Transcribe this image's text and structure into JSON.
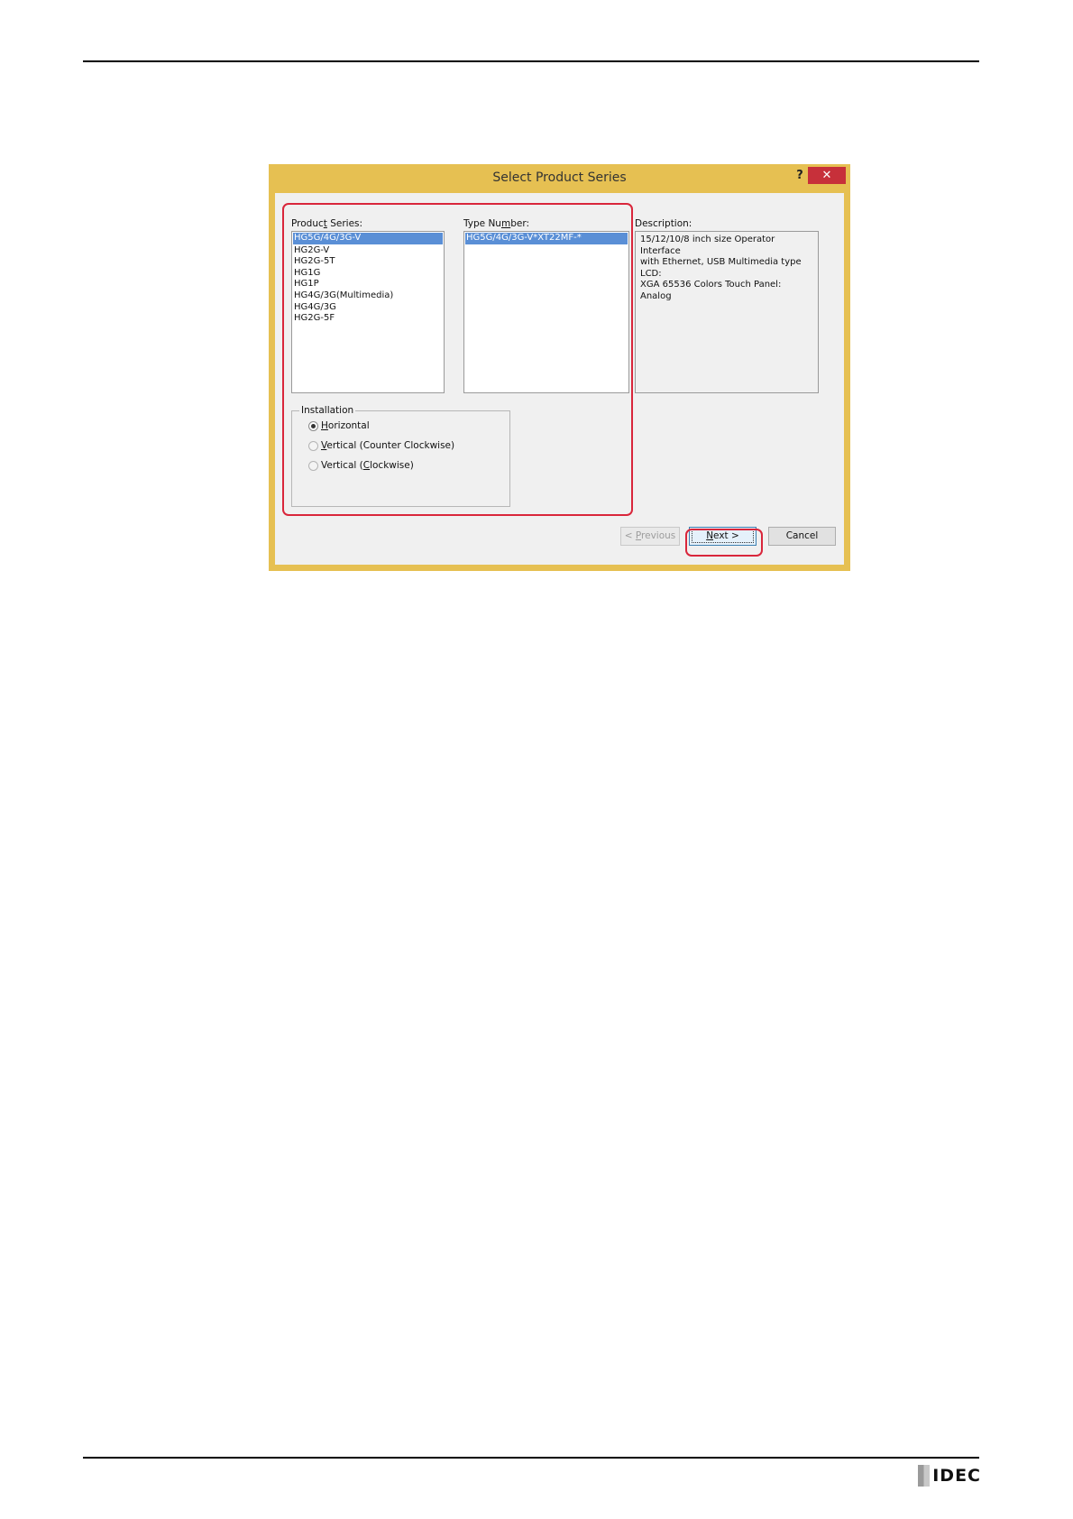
{
  "dialog": {
    "title": "Select Product Series",
    "help_label": "?",
    "close_label": "✕"
  },
  "product_series": {
    "label_pre": "Produc",
    "label_u": "t",
    "label_post": " Series:",
    "items": [
      "HG5G/4G/3G-V",
      "HG2G-V",
      "HG2G-5T",
      "HG1G",
      "HG1P",
      "HG4G/3G(Multimedia)",
      "HG4G/3G",
      "HG2G-5F"
    ],
    "selected": "HG5G/4G/3G-V"
  },
  "type_number": {
    "label_pre": "Type Nu",
    "label_u": "m",
    "label_post": "ber:",
    "items": [
      "HG5G/4G/3G-V*XT22MF-*"
    ]
  },
  "description": {
    "label": "Description:",
    "text_lines": [
      "15/12/10/8 inch size Operator Interface",
      "with Ethernet, USB Multimedia type LCD:",
      "XGA 65536 Colors Touch Panel: Analog"
    ]
  },
  "installation": {
    "legend": "Installation",
    "options": [
      {
        "pre": "",
        "u": "H",
        "post": "orizontal",
        "checked": true
      },
      {
        "pre": "",
        "u": "V",
        "post": "ertical (Counter Clockwise)",
        "checked": false
      },
      {
        "pre": "Vertical (",
        "u": "C",
        "post": "lockwise)",
        "checked": false
      }
    ]
  },
  "buttons": {
    "previous_pre": "< ",
    "previous_u": "P",
    "previous_post": "revious",
    "next_u": "N",
    "next_post": "ext >",
    "cancel": "Cancel"
  },
  "logo": {
    "text": "IDEC"
  },
  "colors": {
    "title_bar": "#e6c052",
    "close_button": "#c7303a",
    "selection": "#5a8fd6",
    "highlight_outline": "#d9263b"
  }
}
